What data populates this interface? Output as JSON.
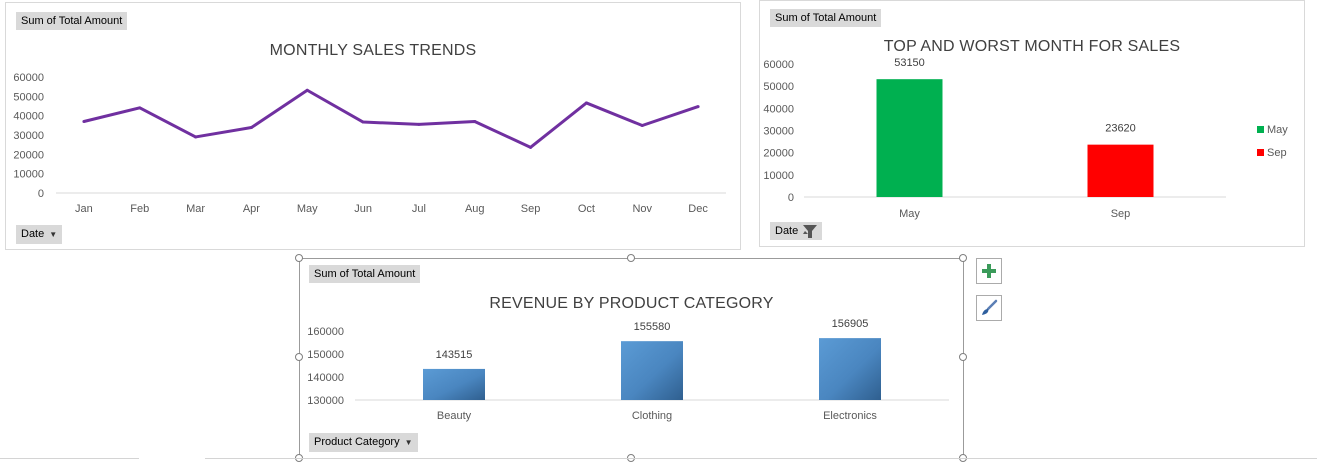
{
  "charts": {
    "monthly": {
      "field_value": "Sum of Total Amount",
      "axis_field": "Date",
      "line_color": "#7030a0"
    },
    "topworst": {
      "field_value": "Sum of Total Amount",
      "axis_field": "Date"
    },
    "category": {
      "field_value": "Sum of Total Amount",
      "axis_field": "Product Category"
    }
  },
  "side_buttons": {
    "add_icon": "plus-icon",
    "style_icon": "brush-icon"
  },
  "chart_data": [
    {
      "type": "line",
      "title": "MONTHLY SALES TRENDS",
      "categories": [
        "Jan",
        "Feb",
        "Mar",
        "Apr",
        "May",
        "Jun",
        "Jul",
        "Aug",
        "Sep",
        "Oct",
        "Nov",
        "Dec"
      ],
      "values": [
        36980,
        44060,
        28990,
        33870,
        53150,
        36715,
        35465,
        36960,
        23620,
        46580,
        34920,
        44690
      ],
      "ylim": [
        0,
        60000
      ],
      "yticks": [
        "60000",
        "50000",
        "40000",
        "30000",
        "20000",
        "10000",
        "0"
      ],
      "grid": false,
      "legend": "none",
      "color": "#7030a0"
    },
    {
      "type": "bar",
      "title": "TOP AND WORST MONTH FOR SALES",
      "categories": [
        "May",
        "Sep"
      ],
      "values": [
        53150,
        23620
      ],
      "data_labels": [
        "53150",
        "23620"
      ],
      "ylim": [
        0,
        60000
      ],
      "yticks": [
        "60000",
        "50000",
        "40000",
        "30000",
        "20000",
        "10000",
        "0"
      ],
      "legend": "right",
      "legend_entries": [
        {
          "label": "May",
          "color": "#00b050"
        },
        {
          "label": "Sep",
          "color": "#ff0000"
        }
      ]
    },
    {
      "type": "bar",
      "title": "REVENUE BY PRODUCT CATEGORY",
      "categories": [
        "Beauty",
        "Clothing",
        "Electronics"
      ],
      "values": [
        143515,
        155580,
        156905
      ],
      "data_labels": [
        "143515",
        "155580",
        "156905"
      ],
      "ylim": [
        130000,
        160000
      ],
      "yticks": [
        "160000",
        "150000",
        "140000",
        "130000"
      ],
      "legend": "none",
      "color": "#5b9bd5"
    }
  ]
}
